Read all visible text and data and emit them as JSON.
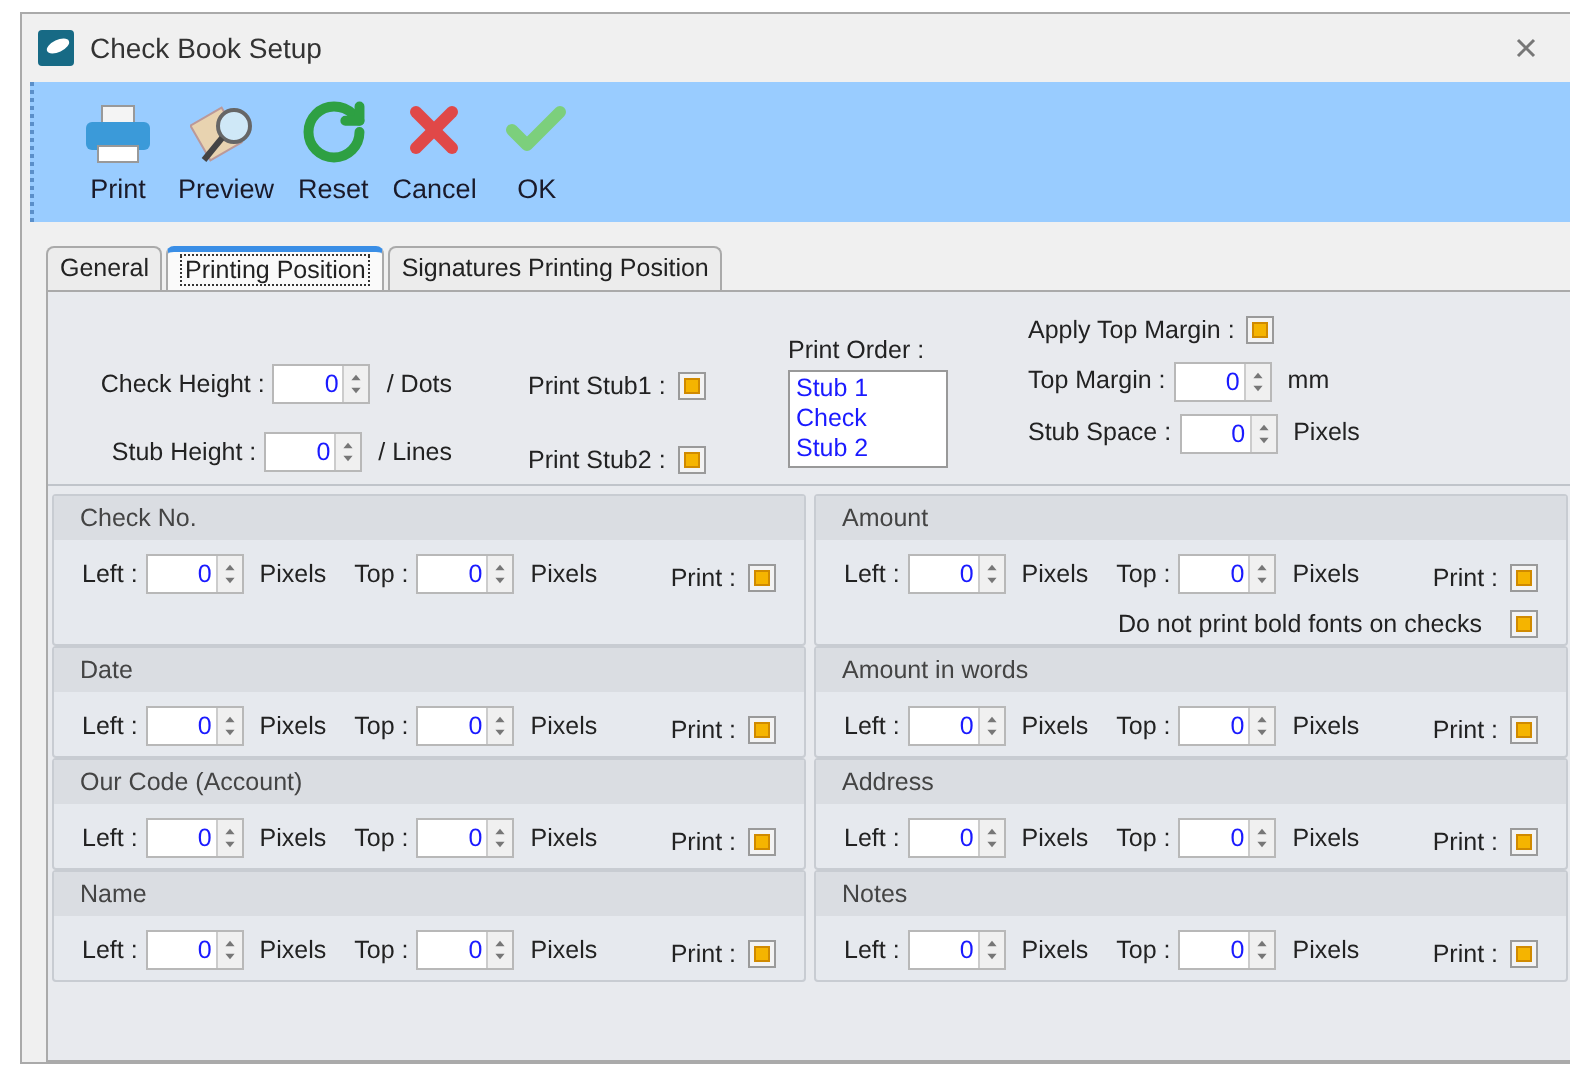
{
  "window": {
    "title": "Check Book Setup"
  },
  "toolbar": [
    {
      "label": "Print",
      "kind": "print"
    },
    {
      "label": "Preview",
      "kind": "preview"
    },
    {
      "label": "Reset",
      "kind": "reset"
    },
    {
      "label": "Cancel",
      "kind": "cancel"
    },
    {
      "label": "OK",
      "kind": "ok"
    }
  ],
  "tabs": [
    {
      "label": "General",
      "selected": false
    },
    {
      "label": "Printing Position",
      "selected": true
    },
    {
      "label": "Signatures Printing Position",
      "selected": false
    }
  ],
  "size_fields": [
    {
      "label": "Check Height :",
      "value": "0",
      "unit": "/ Dots"
    },
    {
      "label": "Stub Height :",
      "value": "0",
      "unit": "/ Lines"
    }
  ],
  "stub_options": [
    {
      "label": "Print Stub1 :",
      "checked": true
    },
    {
      "label": "Print Stub2 :",
      "checked": true
    }
  ],
  "print_order": {
    "label": "Print Order :",
    "items": [
      "Stub 1",
      "Check",
      "Stub 2"
    ]
  },
  "margin": {
    "apply": {
      "label": "Apply Top Margin :",
      "checked": true
    },
    "fields": [
      {
        "label": "Top Margin :",
        "value": "0",
        "unit": "mm"
      },
      {
        "label": "Stub Space :",
        "value": "0",
        "unit": "Pixels"
      }
    ]
  },
  "left_sections": [
    {
      "title": "Check No.",
      "left": {
        "label": "Left :",
        "value": "0",
        "unit": "Pixels"
      },
      "top": {
        "label": "Top :",
        "value": "0",
        "unit": "Pixels"
      },
      "print": {
        "label": "Print :",
        "checked": true
      }
    },
    {
      "title": "Date",
      "left": {
        "label": "Left :",
        "value": "0",
        "unit": "Pixels"
      },
      "top": {
        "label": "Top :",
        "value": "0",
        "unit": "Pixels"
      },
      "print": {
        "label": "Print :",
        "checked": true
      }
    },
    {
      "title": "Our Code (Account)",
      "left": {
        "label": "Left :",
        "value": "0",
        "unit": "Pixels"
      },
      "top": {
        "label": "Top :",
        "value": "0",
        "unit": "Pixels"
      },
      "print": {
        "label": "Print :",
        "checked": true
      }
    },
    {
      "title": "Name",
      "left": {
        "label": "Left :",
        "value": "0",
        "unit": "Pixels"
      },
      "top": {
        "label": "Top :",
        "value": "0",
        "unit": "Pixels"
      },
      "print": {
        "label": "Print :",
        "checked": true
      }
    }
  ],
  "right_sections": [
    {
      "title": "Amount",
      "left": {
        "label": "Left :",
        "value": "0",
        "unit": "Pixels"
      },
      "top": {
        "label": "Top :",
        "value": "0",
        "unit": "Pixels"
      },
      "print": {
        "label": "Print :",
        "checked": true
      },
      "option": {
        "label": "Do not print bold fonts on checks",
        "checked": true
      }
    },
    {
      "title": "Amount in words",
      "left": {
        "label": "Left :",
        "value": "0",
        "unit": "Pixels"
      },
      "top": {
        "label": "Top :",
        "value": "0",
        "unit": "Pixels"
      },
      "print": {
        "label": "Print :",
        "checked": true
      }
    },
    {
      "title": "Address",
      "left": {
        "label": "Left :",
        "value": "0",
        "unit": "Pixels"
      },
      "top": {
        "label": "Top :",
        "value": "0",
        "unit": "Pixels"
      },
      "print": {
        "label": "Print :",
        "checked": true
      }
    },
    {
      "title": "Notes",
      "left": {
        "label": "Left :",
        "value": "0",
        "unit": "Pixels"
      },
      "top": {
        "label": "Top :",
        "value": "0",
        "unit": "Pixels"
      },
      "print": {
        "label": "Print :",
        "checked": true
      }
    }
  ]
}
